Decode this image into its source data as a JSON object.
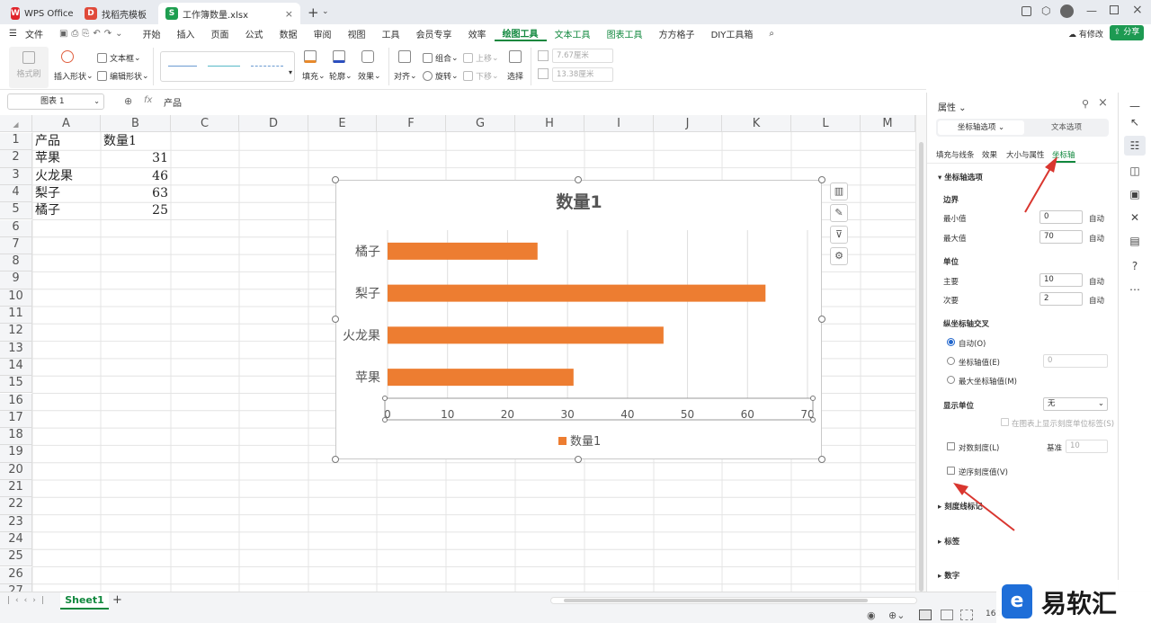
{
  "tabs": [
    {
      "label": "WPS Office",
      "icon": "W"
    },
    {
      "label": "找稻壳模板",
      "icon": "D"
    },
    {
      "label": "工作簿数量.xlsx",
      "icon": "S"
    }
  ],
  "menu": {
    "file": "文件",
    "items": [
      "开始",
      "插入",
      "页面",
      "公式",
      "数据",
      "审阅",
      "视图",
      "工具",
      "会员专享",
      "效率",
      "绘图工具",
      "文本工具",
      "图表工具",
      "方方格子",
      "DIY工具箱"
    ],
    "has_changes": "有修改",
    "share": "分享"
  },
  "ribbon": {
    "format_painter": "格式刷",
    "insert_shape": "插入形状",
    "textbox": "文本框",
    "edit_shape": "编辑形状",
    "fill": "填充",
    "outline": "轮廓",
    "effect": "效果",
    "align": "对齐",
    "group": "组合",
    "rotate": "旋转",
    "up": "上移",
    "down": "下移",
    "select": "选择",
    "width": "7.67厘米",
    "height": "13.38厘米"
  },
  "formula": {
    "name_box": "图表 1",
    "fx": "fx",
    "content": "产品"
  },
  "sheet": {
    "columns": [
      "A",
      "B",
      "C",
      "D",
      "E",
      "F",
      "G",
      "H",
      "I",
      "J",
      "K",
      "L",
      "M"
    ],
    "rows": [
      "1",
      "2",
      "3",
      "4",
      "5",
      "6",
      "7",
      "8",
      "9",
      "10",
      "11",
      "12",
      "13",
      "14",
      "15",
      "16",
      "17",
      "18",
      "19",
      "20",
      "21",
      "22",
      "23",
      "24",
      "25",
      "26",
      "27"
    ],
    "cells": {
      "A1": "产品",
      "B1": "数量1",
      "A2": "苹果",
      "B2": "31",
      "A3": "火龙果",
      "B3": "46",
      "A4": "梨子",
      "B4": "63",
      "A5": "橘子",
      "B5": "25"
    },
    "sheet_tab": "Sheet1",
    "add_sheet": "+"
  },
  "chart_data": {
    "type": "bar",
    "orientation": "horizontal",
    "title": "数量1",
    "categories": [
      "苹果",
      "火龙果",
      "梨子",
      "橘子"
    ],
    "series": [
      {
        "name": "数量1",
        "values": [
          31,
          46,
          63,
          25
        ],
        "color": "#ed7d31"
      }
    ],
    "xlim": [
      0,
      70
    ],
    "xticks": [
      "0",
      "10",
      "20",
      "30",
      "40",
      "50",
      "60",
      "70"
    ],
    "grid": true,
    "legend": "bottom"
  },
  "panel": {
    "title": "属性",
    "tab_axis": "坐标轴选项",
    "tab_text": "文本选项",
    "subtabs": [
      "填充与线条",
      "效果",
      "大小与属性",
      "坐标轴"
    ],
    "section_axis": "坐标轴选项",
    "bounds": "边界",
    "min_label": "最小值",
    "min_value": "0",
    "auto": "自动",
    "max_label": "最大值",
    "max_value": "70",
    "unit": "单位",
    "major_label": "主要",
    "major_value": "10",
    "minor_label": "次要",
    "minor_value": "2",
    "cross": "纵坐标轴交叉",
    "cross_auto": "自动(O)",
    "cross_value": "坐标轴值(E)",
    "cross_value_input": "0",
    "cross_max": "最大坐标轴值(M)",
    "display_unit": "显示单位",
    "display_unit_value": "无",
    "show_unit_label": "在图表上显示刻度单位标签(S)",
    "log_scale": "对数刻度(L)",
    "base": "基准",
    "base_value": "10",
    "reverse": "逆序刻度值(V)",
    "tick_marks": "刻度线标记",
    "labels": "标签",
    "number": "数字"
  },
  "status": {
    "zoom": "160"
  },
  "watermark": "易软汇",
  "colors": {
    "accent": "#11883e",
    "bar": "#ed7d31",
    "arrow": "#d9362f"
  }
}
